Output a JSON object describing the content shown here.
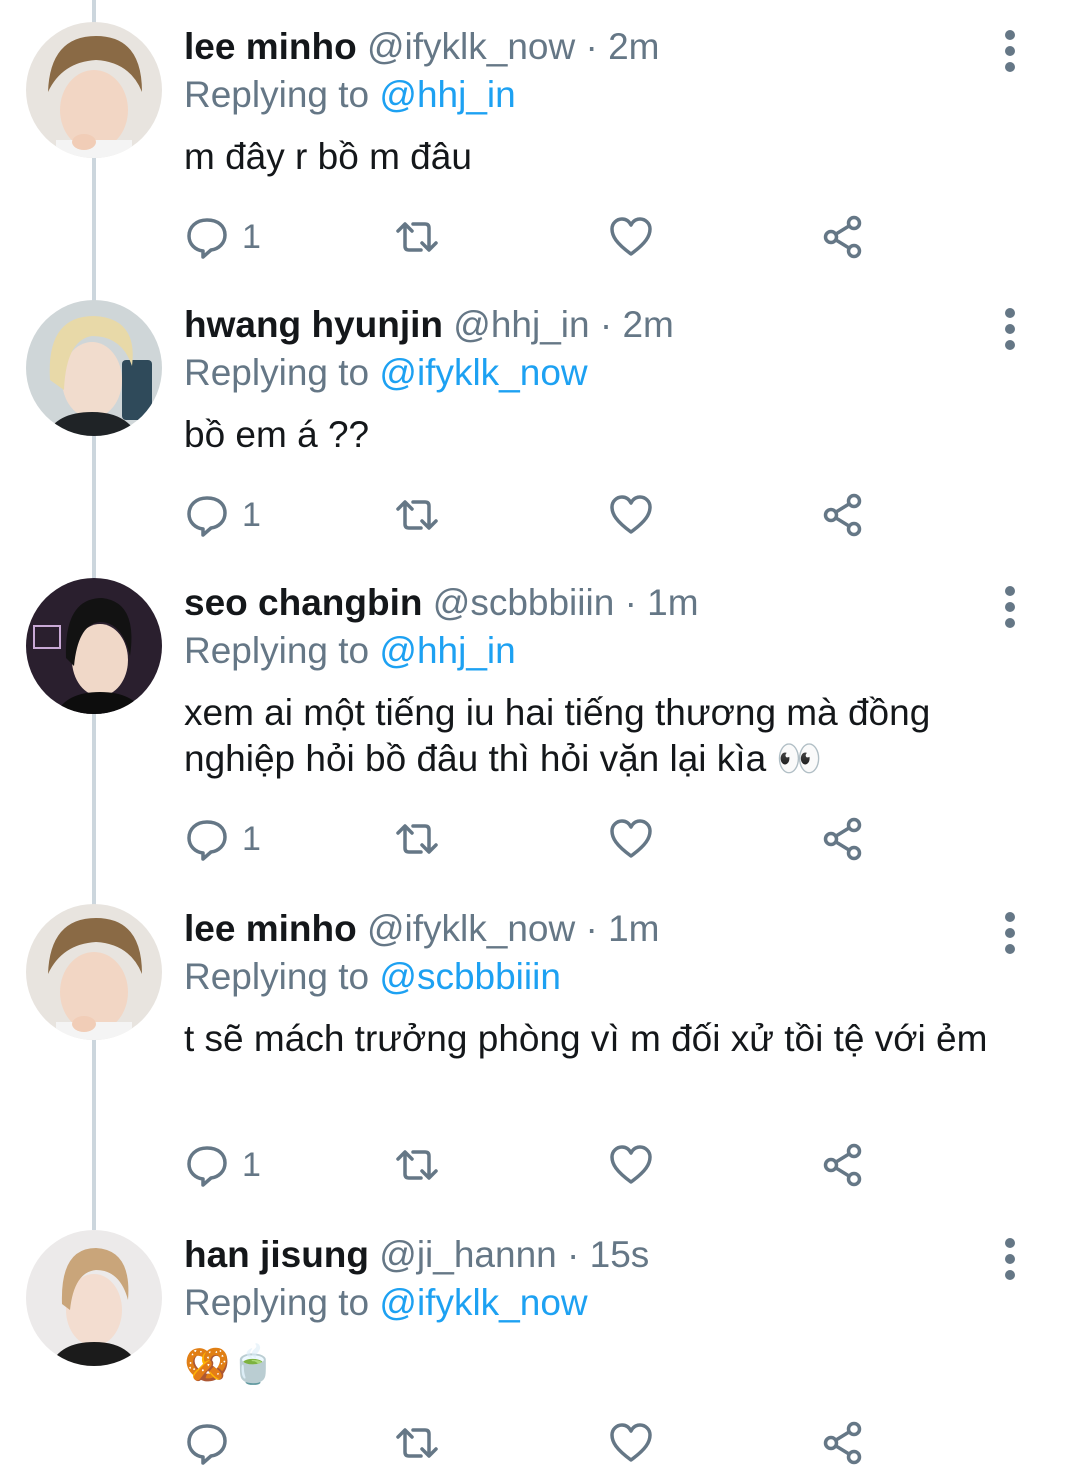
{
  "tweets": [
    {
      "name": "lee minho",
      "handle": "@ifyklk_now",
      "time": "· 2m",
      "replying_to_label": "Replying to",
      "replying_to": "@hhj_in",
      "text": "m đây r bồ m đâu",
      "reply_count": "1",
      "avatar": "hair-brown"
    },
    {
      "name": "hwang hyunjin",
      "handle": "@hhj_in",
      "time": "· 2m",
      "replying_to_label": "Replying to",
      "replying_to": "@ifyklk_now",
      "text": "bồ em á ??",
      "reply_count": "1",
      "avatar": "hair-blonde"
    },
    {
      "name": "seo changbin",
      "handle": "@scbbbiiin",
      "time": "· 1m",
      "replying_to_label": "Replying to",
      "replying_to": "@hhj_in",
      "text": "xem ai một tiếng iu hai tiếng thương mà đồng nghiệp hỏi bồ đâu thì hỏi vặn lại kìa 👀",
      "reply_count": "1",
      "avatar": "hair-black"
    },
    {
      "name": "lee minho",
      "handle": "@ifyklk_now",
      "time": "· 1m",
      "replying_to_label": "Replying to",
      "replying_to": "@scbbbiiin",
      "text": "t sẽ mách trưởng phòng vì m đối xử tồi tệ với ẻm",
      "reply_count": "1",
      "avatar": "hair-brown"
    },
    {
      "name": "han jisung",
      "handle": "@ji_hannn",
      "time": "· 15s",
      "replying_to_label": "Replying to",
      "replying_to": "@ifyklk_now",
      "text": "🥨🍵",
      "reply_count": "",
      "avatar": "hair-light"
    }
  ],
  "icons": {
    "reply": "comment-icon",
    "retweet": "retweet-icon",
    "like": "heart-icon",
    "share": "share-icon",
    "more": "more-vertical-icon"
  },
  "colors": {
    "mention": "#1da1f2",
    "meta": "#657786",
    "thread_line": "#ccd6dd"
  }
}
